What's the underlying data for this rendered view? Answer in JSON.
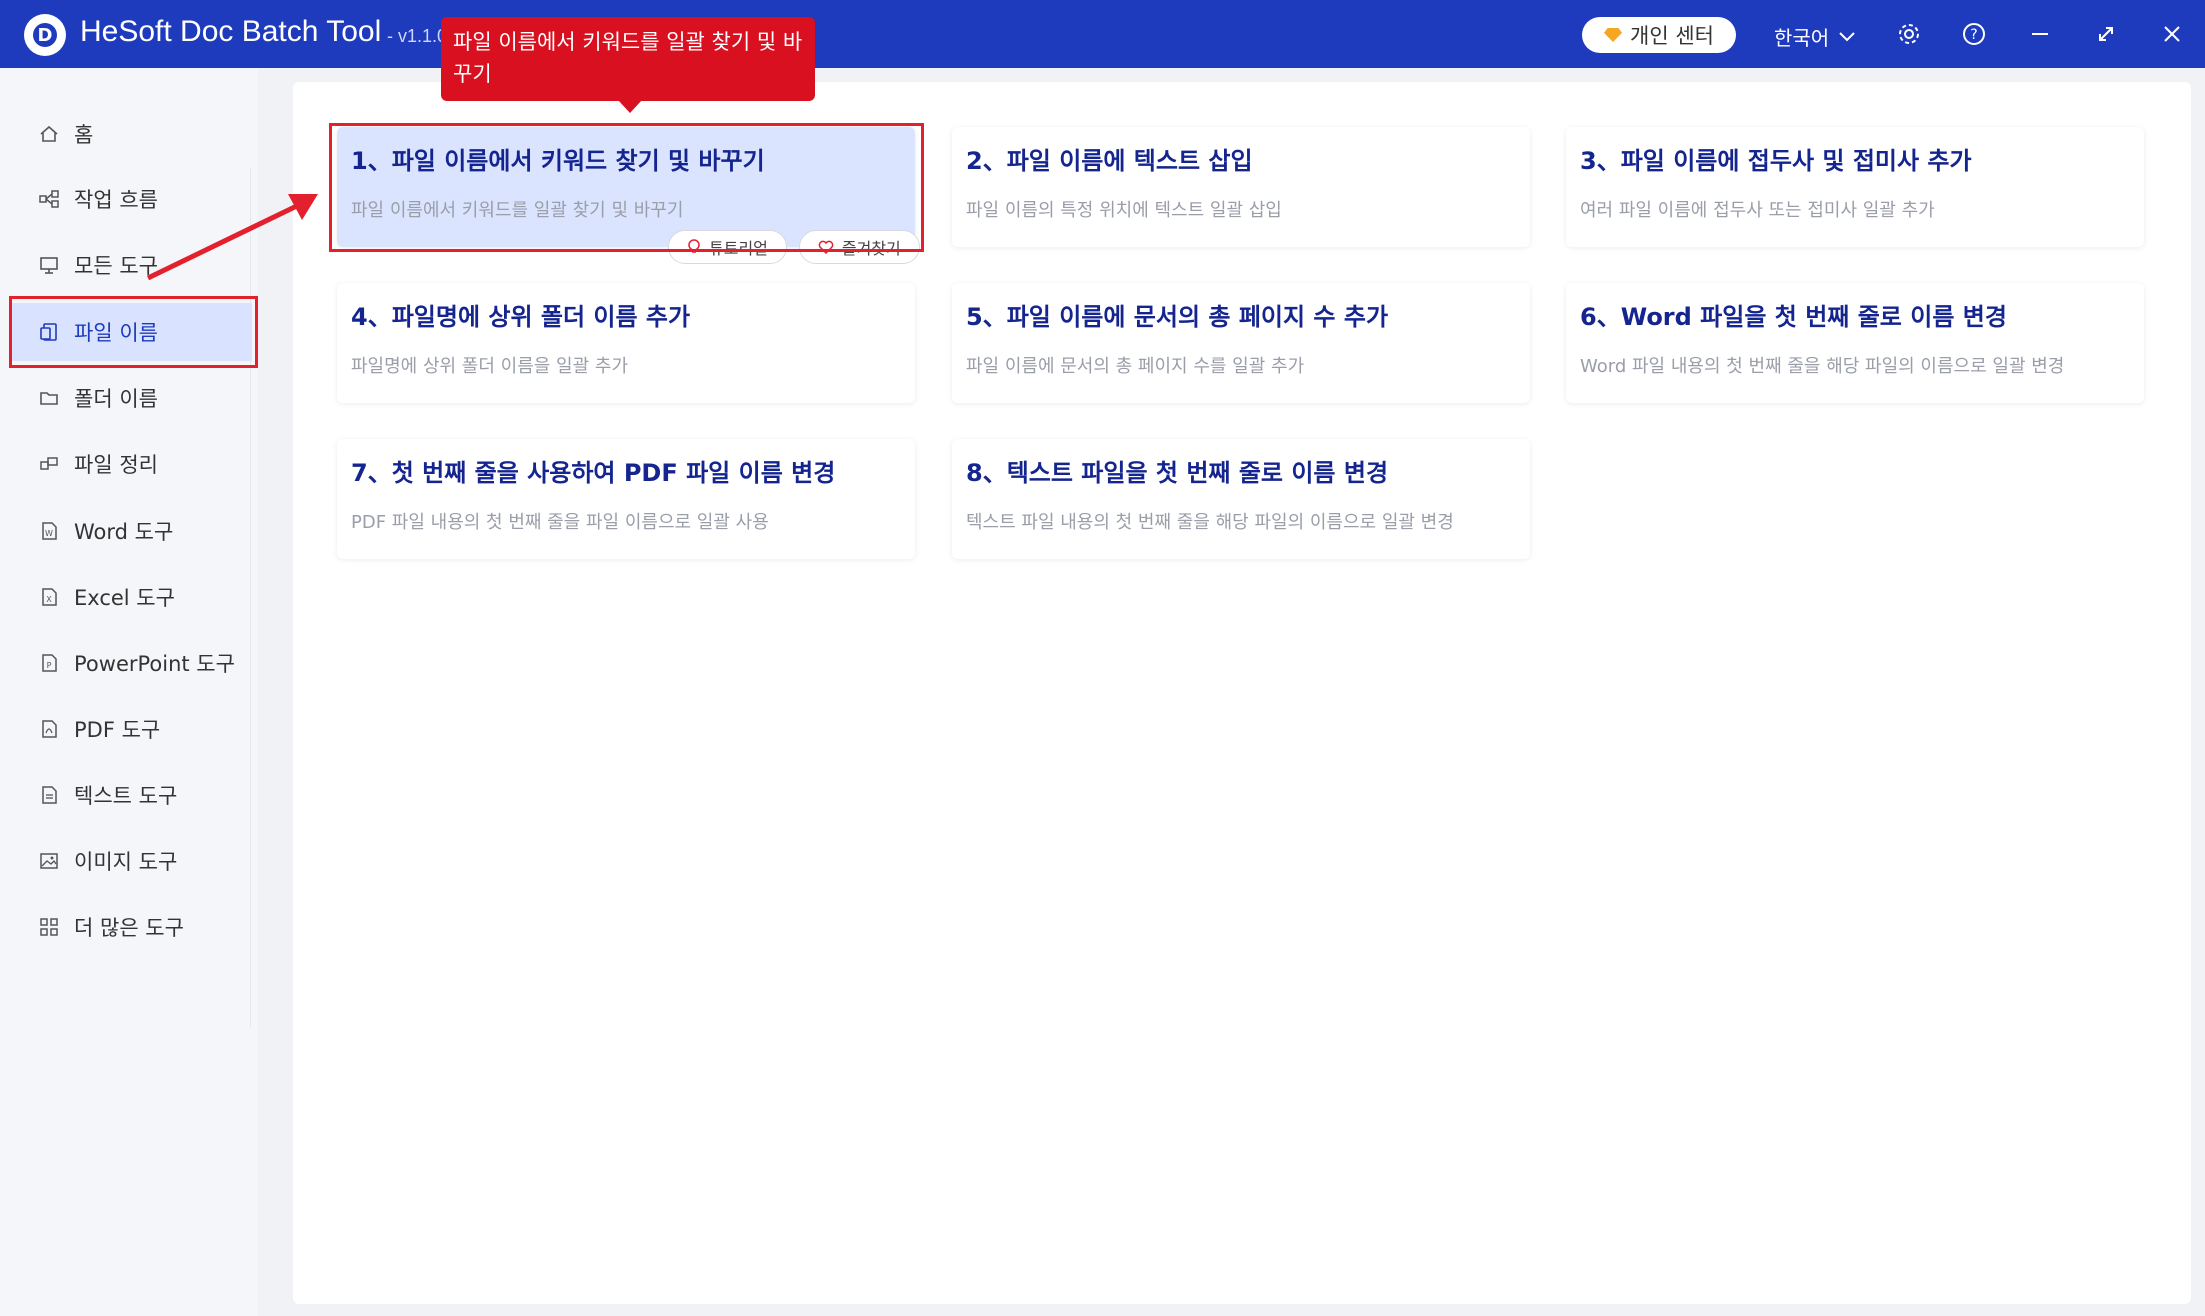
{
  "window": {
    "app_title": "HeSoft Doc Batch Tool",
    "version": "- v1.1.0",
    "account_button": "개인 센터",
    "language": "한국어",
    "icons": [
      "settings-icon",
      "help-icon",
      "minimize-icon",
      "maximize-icon",
      "close-icon"
    ]
  },
  "sidebar": {
    "items": [
      {
        "label": "홈",
        "icon": "home-icon"
      },
      {
        "label": "작업 흐름",
        "icon": "workflow-icon"
      },
      {
        "label": "모든 도구",
        "icon": "monitor-icon"
      },
      {
        "label": "파일 이름",
        "icon": "file-rename-icon",
        "active": true
      },
      {
        "label": "폴더 이름",
        "icon": "folder-icon"
      },
      {
        "label": "파일 정리",
        "icon": "organize-icon"
      },
      {
        "label": "Word 도구",
        "icon": "word-icon"
      },
      {
        "label": "Excel 도구",
        "icon": "excel-icon"
      },
      {
        "label": "PowerPoint 도구",
        "icon": "powerpoint-icon"
      },
      {
        "label": "PDF 도구",
        "icon": "pdf-icon"
      },
      {
        "label": "텍스트 도구",
        "icon": "text-icon"
      },
      {
        "label": "이미지 도구",
        "icon": "image-icon"
      },
      {
        "label": "더 많은 도구",
        "icon": "grid-icon"
      }
    ]
  },
  "tooltip": {
    "text": "파일 이름에서 키워드를 일괄 찾기 및 바꾸기"
  },
  "cards": [
    {
      "title": "1、파일 이름에서 키워드 찾기 및 바꾸기",
      "desc": "파일 이름에서 키워드를 일괄 찾기 및 바꾸기",
      "selected": true
    },
    {
      "title": "2、파일 이름에 텍스트 삽입",
      "desc": "파일 이름의 특정 위치에 텍스트 일괄 삽입"
    },
    {
      "title": "3、파일 이름에 접두사 및 접미사 추가",
      "desc": "여러 파일 이름에 접두사 또는 접미사 일괄 추가"
    },
    {
      "title": "4、파일명에 상위 폴더 이름 추가",
      "desc": "파일명에 상위 폴더 이름을 일괄 추가"
    },
    {
      "title": "5、파일 이름에 문서의 총 페이지 수 추가",
      "desc": "파일 이름에 문서의 총 페이지 수를 일괄 추가"
    },
    {
      "title": "6、Word 파일을 첫 번째 줄로 이름 변경",
      "desc": "Word 파일 내용의 첫 번째 줄을 해당 파일의 이름으로 일괄 변경"
    },
    {
      "title": "7、첫 번째 줄을 사용하여 PDF 파일 이름 변경",
      "desc": "PDF 파일 내용의 첫 번째 줄을 파일 이름으로 일괄 사용"
    },
    {
      "title": "8、텍스트 파일을 첫 번째 줄로 이름 변경",
      "desc": "텍스트 파일 내용의 첫 번째 줄을 해당 파일의 이름으로 일괄 변경"
    }
  ],
  "card_actions": {
    "tutorial": "튜토리얼",
    "favorite": "즐겨찾기"
  },
  "colors": {
    "titlebar": "#1f3bbd",
    "accent": "#15258f",
    "highlight": "#e3202e",
    "selected_card": "#dbe4ff"
  }
}
